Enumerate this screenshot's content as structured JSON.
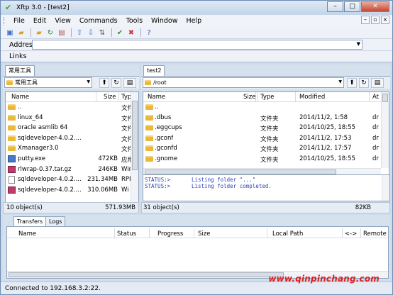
{
  "titlebar": {
    "title": "Xftp 3.0 - [test2]"
  },
  "menubar": {
    "items": [
      "File",
      "Edit",
      "View",
      "Commands",
      "Tools",
      "Window",
      "Help"
    ]
  },
  "addressbar": {
    "label": "Address",
    "value": ""
  },
  "linksbar": {
    "label": "Links"
  },
  "left_pane": {
    "tab": "常用工具",
    "path": "常用工具",
    "columns": {
      "name": "Name",
      "size": "Size",
      "type": "Typ"
    },
    "rows": [
      {
        "name": "..",
        "size": "",
        "type": "文件",
        "icon": "folder-icon"
      },
      {
        "name": "linux_64",
        "size": "",
        "type": "文件",
        "icon": "folder-icon"
      },
      {
        "name": "oracle asmlib 64",
        "size": "",
        "type": "文件",
        "icon": "folder-icon"
      },
      {
        "name": "sqldeveloper-4.0.2....",
        "size": "",
        "type": "文件",
        "icon": "folder-icon"
      },
      {
        "name": "Xmanager3.0",
        "size": "",
        "type": "文件",
        "icon": "folder-icon"
      },
      {
        "name": "putty.exe",
        "size": "472KB",
        "type": "应用",
        "icon": "putty-icon"
      },
      {
        "name": "rlwrap-0.37.tar.gz",
        "size": "246KB",
        "type": "Win",
        "icon": "archive-icon"
      },
      {
        "name": "sqldeveloper-4.0.2....",
        "size": "231.34MB",
        "type": "RPI",
        "icon": "file-icon"
      },
      {
        "name": "sqldeveloper-4.0.2....",
        "size": "310.06MB",
        "type": "Wi",
        "icon": "archive-icon"
      }
    ],
    "count": "10 object(s)",
    "total": "571.93MB"
  },
  "right_pane": {
    "tab": "test2",
    "path": "/root",
    "columns": {
      "name": "Name",
      "size": "Size",
      "type": "Type",
      "modified": "Modified",
      "attr": "At"
    },
    "rows": [
      {
        "name": "..",
        "size": "",
        "type": "",
        "modified": "",
        "attr": ""
      },
      {
        "name": ".dbus",
        "size": "",
        "type": "文件夹",
        "modified": "2014/11/2, 1:58",
        "attr": "dr"
      },
      {
        "name": ".eggcups",
        "size": "",
        "type": "文件夹",
        "modified": "2014/10/25, 18:55",
        "attr": "dr"
      },
      {
        "name": ".gconf",
        "size": "",
        "type": "文件夹",
        "modified": "2014/11/2, 17:53",
        "attr": "dr"
      },
      {
        "name": ".gconfd",
        "size": "",
        "type": "文件夹",
        "modified": "2014/11/2, 17:57",
        "attr": "dr"
      },
      {
        "name": ".gnome",
        "size": "",
        "type": "文件夹",
        "modified": "2014/10/25, 18:55",
        "attr": "dr"
      }
    ],
    "count": "31 object(s)",
    "total": "82KB",
    "status_lines": [
      {
        "label": "STATUS:>",
        "message": "Listing folder \"...\""
      },
      {
        "label": "STATUS:>",
        "message": "Listing folder completed."
      }
    ]
  },
  "transfer": {
    "tabs": [
      "Transfers",
      "Logs"
    ],
    "columns": [
      "Name",
      "Status",
      "Progress",
      "Size",
      "Local Path",
      "<->",
      "Remote"
    ]
  },
  "statusbar": {
    "text": "Connected to 192.168.3.2:22."
  },
  "watermark": "www.qinpinchang.com"
}
